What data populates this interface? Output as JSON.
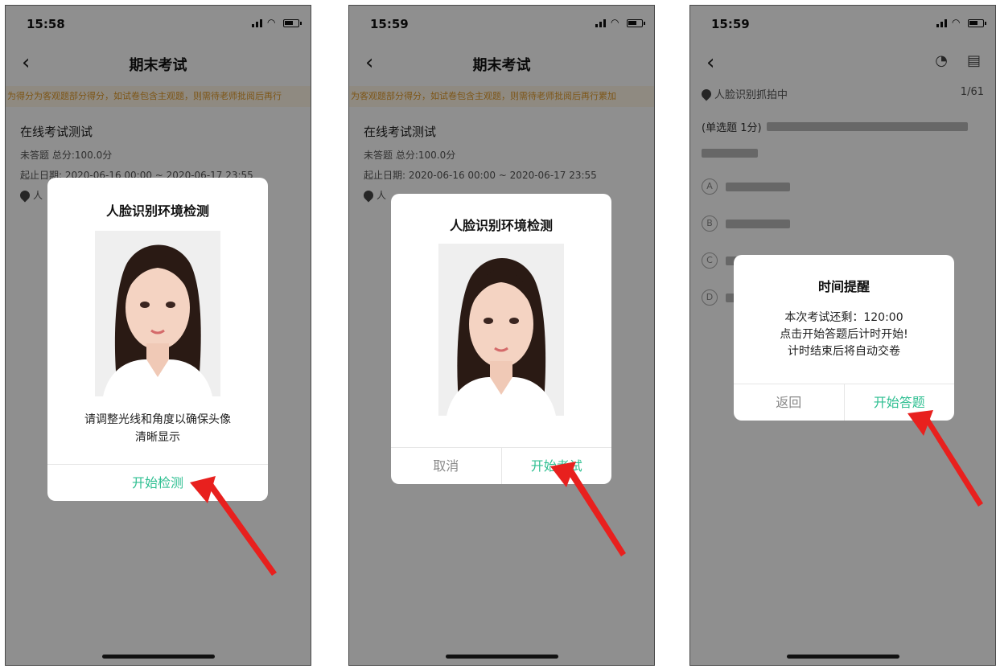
{
  "colors": {
    "accent": "#2ebf91",
    "notice_text": "#e09a2a",
    "arrow": "#e8201e"
  },
  "screen1": {
    "time": "15:58",
    "nav_title": "期末考试",
    "notice": "为得分为客观题部分得分，如试卷包含主观题，则需待老师批阅后再行",
    "exam_title": "在线考试测试",
    "exam_meta": "未答题  总分:100.0分",
    "exam_date": "起止日期: 2020-06-16 00:00 ~ 2020-06-17 23:55",
    "exam_face": "人",
    "modal": {
      "title": "人脸识别环境检测",
      "message_line1": "请调整光线和角度以确保头像",
      "message_line2": "清晰显示",
      "button": "开始检测"
    }
  },
  "screen2": {
    "time": "15:59",
    "nav_title": "期末考试",
    "notice": "为客观题部分得分，如试卷包含主观题，则需待老师批阅后再行累加",
    "exam_title": "在线考试测试",
    "exam_meta": "未答题  总分:100.0分",
    "exam_date": "起止日期: 2020-06-16 00:00 ~ 2020-06-17 23:55",
    "exam_face": "人",
    "modal": {
      "title": "人脸识别环境检测",
      "cancel": "取消",
      "start": "开始考试"
    }
  },
  "screen3": {
    "time": "15:59",
    "face_status": "人脸识别抓拍中",
    "page_counter": "1/61",
    "question_type": "(单选题 1分)",
    "options": [
      "A",
      "B",
      "C",
      "D"
    ],
    "modal": {
      "title": "时间提醒",
      "line1": "本次考试还剩：120:00",
      "line2": "点击开始答题后计时开始!",
      "line3": "计时结束后将自动交卷",
      "back": "返回",
      "start": "开始答题"
    }
  }
}
